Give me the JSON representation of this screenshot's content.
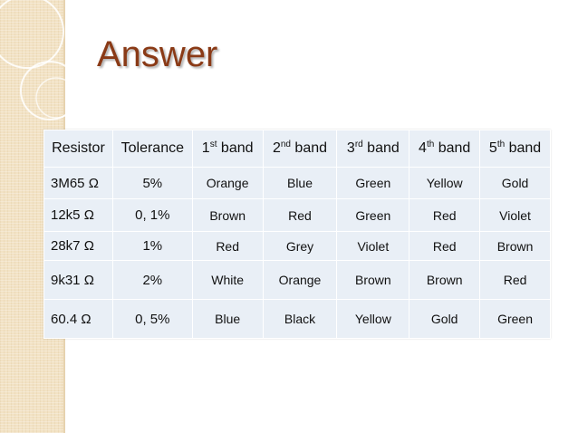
{
  "slide": {
    "title": "Answer"
  },
  "table": {
    "headers": [
      {
        "main": "Resistor",
        "sup": "",
        "rest": ""
      },
      {
        "main": "Tolerance",
        "sup": "",
        "rest": ""
      },
      {
        "main": "1",
        "sup": "st",
        "rest": " band"
      },
      {
        "main": "2",
        "sup": "nd",
        "rest": " band"
      },
      {
        "main": "3",
        "sup": "rd",
        "rest": " band"
      },
      {
        "main": "4",
        "sup": "th",
        "rest": " band"
      },
      {
        "main": "5",
        "sup": "th",
        "rest": " band"
      }
    ],
    "rows": [
      [
        "3M65 Ω",
        "5%",
        "Orange",
        "Blue",
        "Green",
        "Yellow",
        "Gold"
      ],
      [
        "12k5  Ω",
        "0, 1%",
        "Brown",
        "Red",
        "Green",
        "Red",
        "Violet"
      ],
      [
        "28k7 Ω",
        "1%",
        "Red",
        "Grey",
        "Violet",
        "Red",
        "Brown"
      ],
      [
        "9k31 Ω",
        "2%",
        "White",
        "Orange",
        "Brown",
        "Brown",
        "Red"
      ],
      [
        "60.4 Ω",
        "0, 5%",
        "Blue",
        "Black",
        "Yellow",
        "Gold",
        "Green"
      ]
    ]
  }
}
